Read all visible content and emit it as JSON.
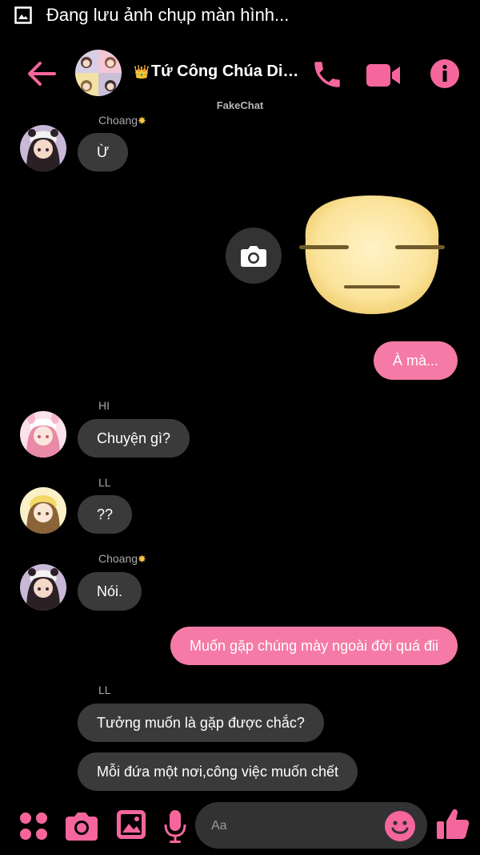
{
  "status_bar": {
    "text": "Đang lưu ảnh chụp màn hình..."
  },
  "header": {
    "title": "Tứ Công Chúa Diên...",
    "crown": "👑",
    "watermark": "FakeChat"
  },
  "messages": [
    {
      "sender": "Choang",
      "sender_badge": "✸",
      "text": "Ừ"
    },
    {
      "sent": true,
      "type": "sticker",
      "sticker": "expressionless-face"
    },
    {
      "sent": true,
      "text": "À mà..."
    },
    {
      "sender": "HI",
      "text": "Chuyện gì?"
    },
    {
      "sender": "LL",
      "text": "??"
    },
    {
      "sender": "Choang",
      "sender_badge": "✸",
      "text": "Nói."
    },
    {
      "sent": true,
      "text": "Muốn gặp chúng mày ngoài đời quá đii"
    },
    {
      "sender": "LL",
      "text": "Tưởng muốn là gặp được chắc?"
    },
    {
      "sender": "LL",
      "text": "Mỗi đứa một nơi,công việc muốn chết"
    }
  ],
  "composer": {
    "placeholder": "Aa"
  },
  "colors": {
    "accent": "#f5669d",
    "incoming_bubble": "#3a3a3a",
    "outgoing_bubble": "#f57aa6"
  }
}
